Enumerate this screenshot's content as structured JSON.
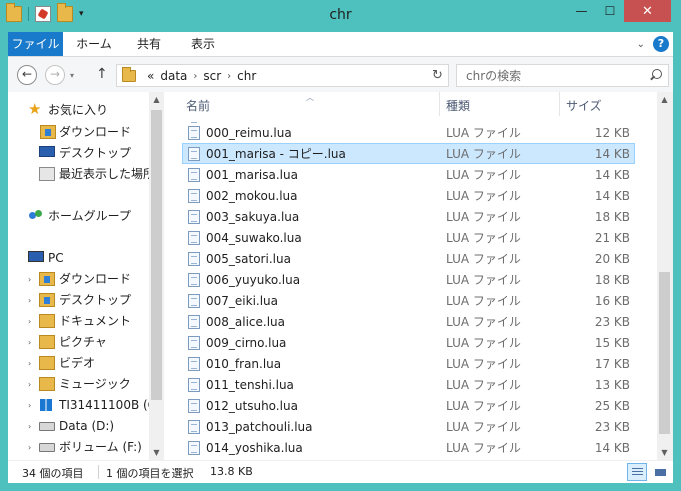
{
  "window": {
    "title": "chr"
  },
  "ribbon": {
    "tabs": [
      {
        "label": "ファイル"
      },
      {
        "label": "ホーム"
      },
      {
        "label": "共有"
      },
      {
        "label": "表示"
      }
    ]
  },
  "address": {
    "overflow": "«",
    "crumbs": [
      "data",
      "scr",
      "chr"
    ]
  },
  "search": {
    "placeholder": "chrの検索"
  },
  "nav": {
    "favorites": "お気に入り",
    "fav_items": [
      "ダウンロード",
      "デスクトップ",
      "最近表示した場所"
    ],
    "homegroup": "ホームグループ",
    "pc": "PC",
    "pc_items": [
      "ダウンロード",
      "デスクトップ",
      "ドキュメント",
      "ピクチャ",
      "ビデオ",
      "ミュージック",
      "TI31411100B (C",
      "Data (D:)",
      "ボリューム (F:)"
    ]
  },
  "columns": {
    "name": "名前",
    "type": "種類",
    "size": "サイズ"
  },
  "files": [
    {
      "name": "000_reimu.lua",
      "type": "LUA ファイル",
      "size": "12 KB"
    },
    {
      "name": "001_marisa - コピー.lua",
      "type": "LUA ファイル",
      "size": "14 KB",
      "selected": true
    },
    {
      "name": "001_marisa.lua",
      "type": "LUA ファイル",
      "size": "14 KB"
    },
    {
      "name": "002_mokou.lua",
      "type": "LUA ファイル",
      "size": "14 KB"
    },
    {
      "name": "003_sakuya.lua",
      "type": "LUA ファイル",
      "size": "18 KB"
    },
    {
      "name": "004_suwako.lua",
      "type": "LUA ファイル",
      "size": "21 KB"
    },
    {
      "name": "005_satori.lua",
      "type": "LUA ファイル",
      "size": "20 KB"
    },
    {
      "name": "006_yuyuko.lua",
      "type": "LUA ファイル",
      "size": "18 KB"
    },
    {
      "name": "007_eiki.lua",
      "type": "LUA ファイル",
      "size": "16 KB"
    },
    {
      "name": "008_alice.lua",
      "type": "LUA ファイル",
      "size": "23 KB"
    },
    {
      "name": "009_cirno.lua",
      "type": "LUA ファイル",
      "size": "15 KB"
    },
    {
      "name": "010_fran.lua",
      "type": "LUA ファイル",
      "size": "17 KB"
    },
    {
      "name": "011_tenshi.lua",
      "type": "LUA ファイル",
      "size": "13 KB"
    },
    {
      "name": "012_utsuho.lua",
      "type": "LUA ファイル",
      "size": "25 KB"
    },
    {
      "name": "013_patchouli.lua",
      "type": "LUA ファイル",
      "size": "23 KB"
    },
    {
      "name": "014_yoshika.lua",
      "type": "LUA ファイル",
      "size": "14 KB"
    }
  ],
  "status": {
    "count": "34 個の項目",
    "selection": "1 個の項目を選択",
    "selection_size": "13.8 KB"
  }
}
